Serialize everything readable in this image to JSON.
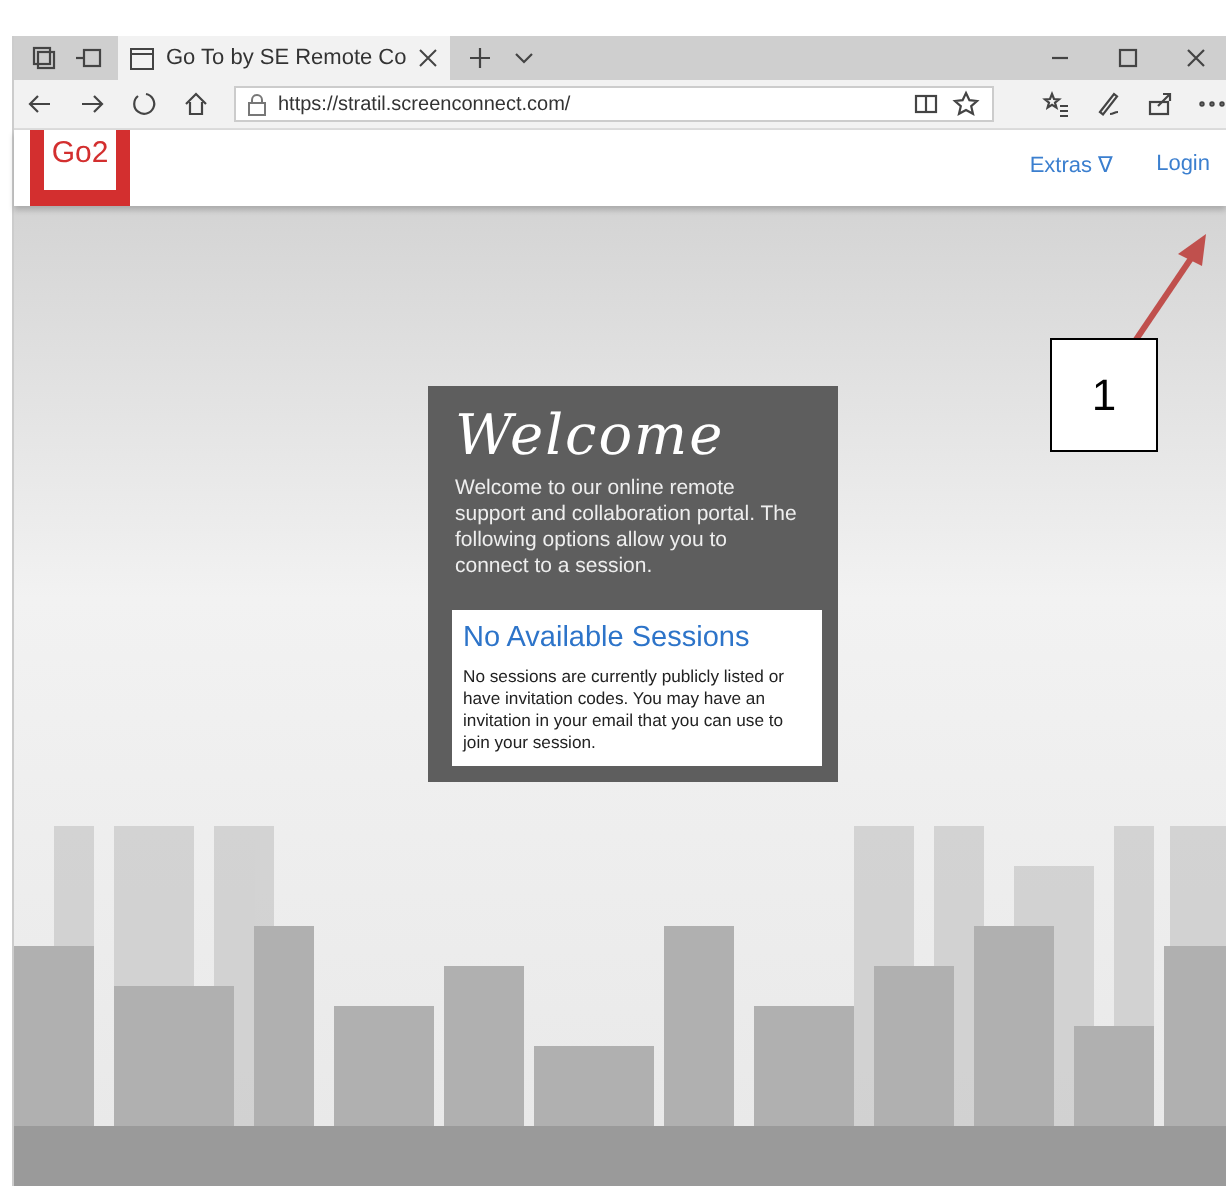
{
  "browser": {
    "tab": {
      "title": "Go To by SE Remote Co",
      "selected": true
    },
    "address": "https://stratil.screenconnect.com/"
  },
  "header": {
    "logo": "Go2",
    "nav": [
      {
        "label": "Extras",
        "caret": "∇"
      },
      {
        "label": "Login"
      }
    ]
  },
  "welcome": {
    "title": "Welcome",
    "text": "Welcome to our online remote support and collaboration portal. The following options allow you to connect to a session.",
    "sessions": {
      "title": "No Available Sessions",
      "text": "No sessions are currently publicly listed or have invitation codes. You may have an invitation in your email that you can use to join your session."
    }
  },
  "annotation": {
    "number": "1"
  }
}
